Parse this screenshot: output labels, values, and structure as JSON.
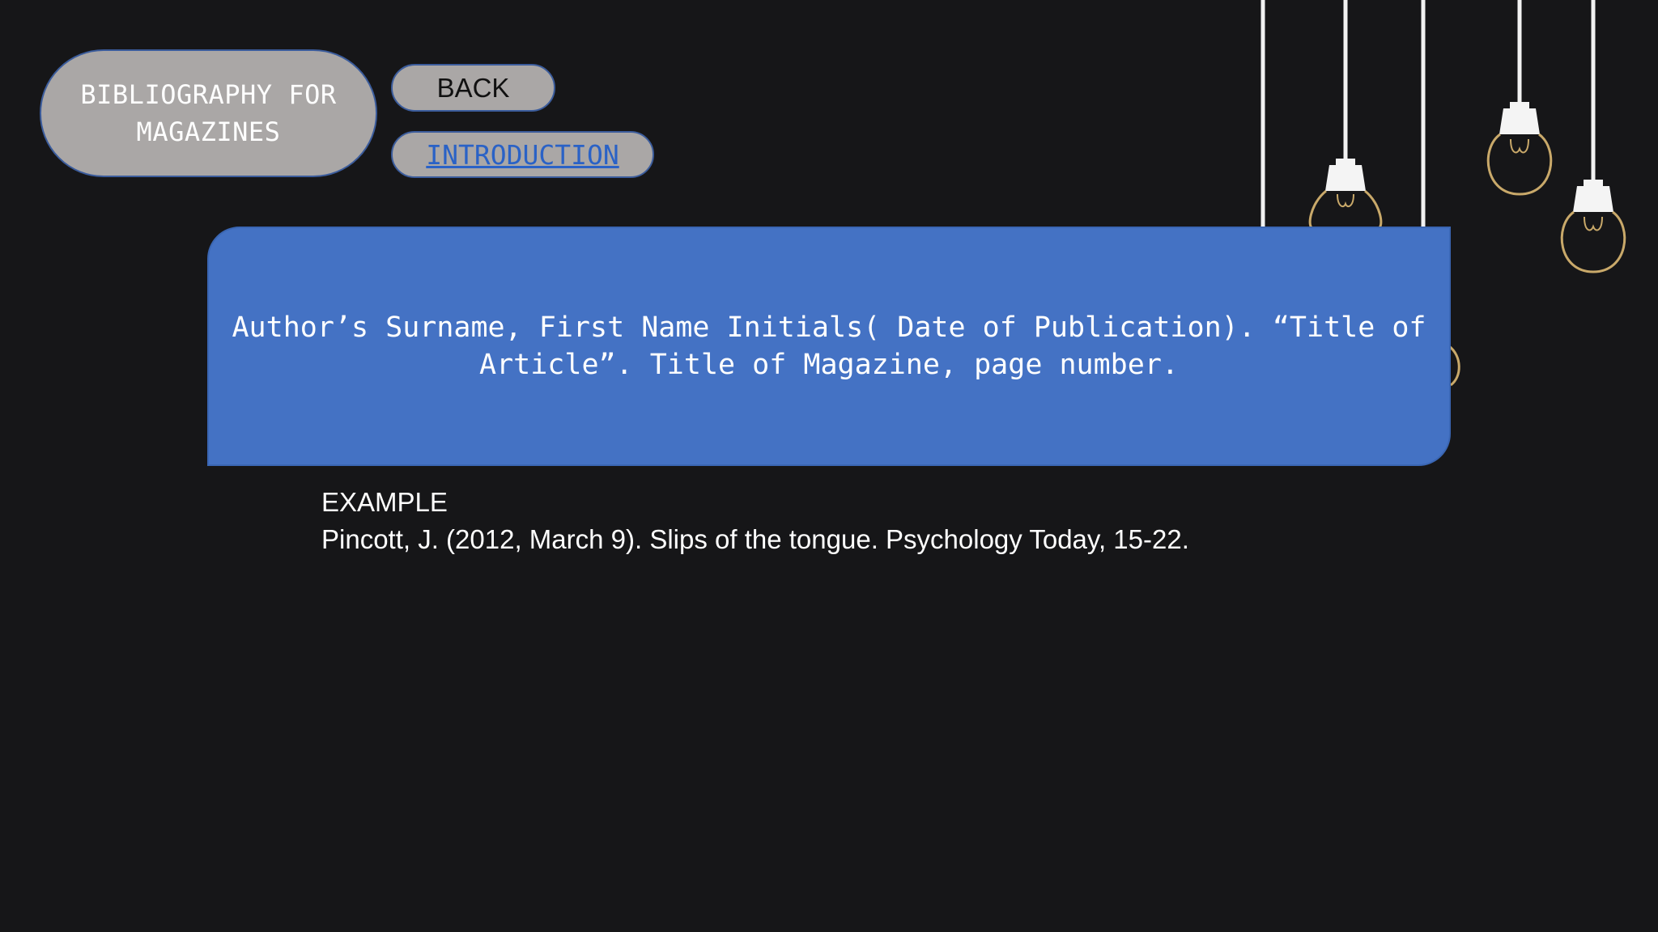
{
  "title": {
    "text": "BIBLIOGRAPHY FOR MAGAZINES"
  },
  "nav": {
    "back_label": "BACK",
    "introduction_label": "INTRODUCTION"
  },
  "format": {
    "text": "Author’s Surname, First Name Initials( Date of Publication). “Title of Article”. Title of Magazine, page number."
  },
  "example": {
    "heading": "EXAMPLE",
    "citation": "Pincott, J. (2012, March 9). Slips of the tongue. Psychology Today, 15-22."
  },
  "colors": {
    "background": "#161618",
    "pill_fill": "#aaa7a6",
    "box_fill": "#4472c4",
    "link": "#2a62c6",
    "bulb_outline": "#c9a96a"
  },
  "decoration": {
    "icon": "hanging-light-bulbs-icon"
  }
}
